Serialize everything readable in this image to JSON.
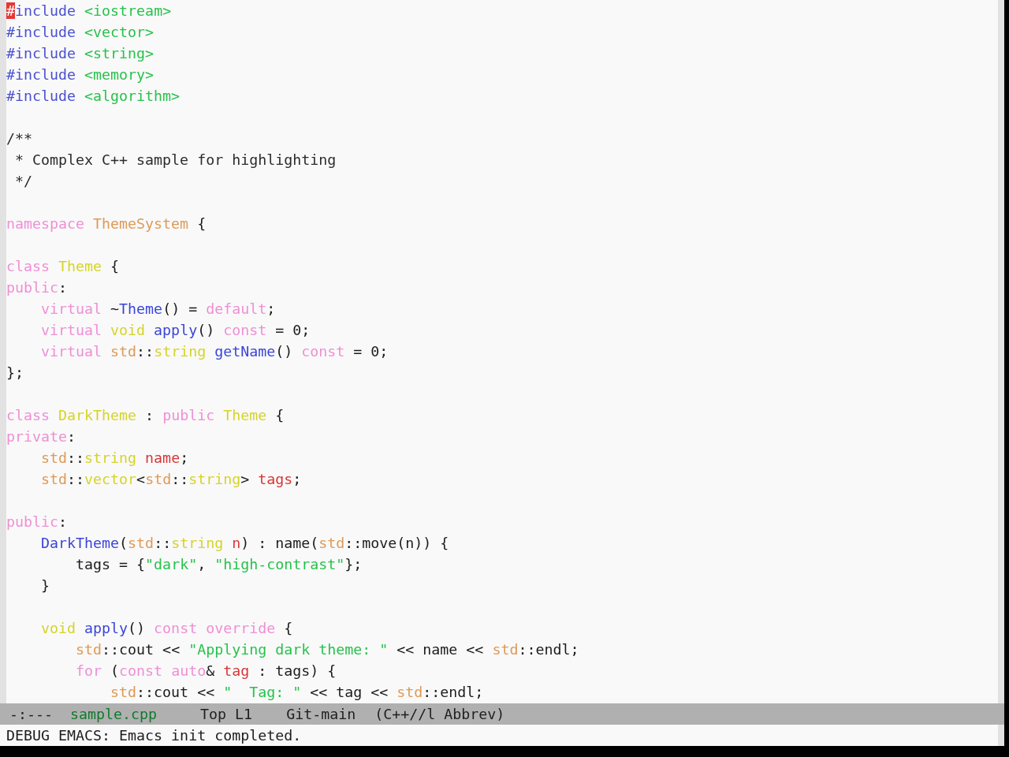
{
  "editor": {
    "lines": [
      {
        "kind": "code",
        "tokens": [
          {
            "text": "#",
            "kind": "cursor"
          },
          {
            "text": "include ",
            "kind": "preprocessor"
          },
          {
            "text": "<iostream>",
            "kind": "string"
          }
        ]
      },
      {
        "kind": "code",
        "tokens": [
          {
            "text": "#include ",
            "kind": "preprocessor"
          },
          {
            "text": "<vector>",
            "kind": "string"
          }
        ]
      },
      {
        "kind": "code",
        "tokens": [
          {
            "text": "#include ",
            "kind": "preprocessor"
          },
          {
            "text": "<string>",
            "kind": "string"
          }
        ]
      },
      {
        "kind": "code",
        "tokens": [
          {
            "text": "#include ",
            "kind": "preprocessor"
          },
          {
            "text": "<memory>",
            "kind": "string"
          }
        ]
      },
      {
        "kind": "code",
        "tokens": [
          {
            "text": "#include ",
            "kind": "preprocessor"
          },
          {
            "text": "<algorithm>",
            "kind": "string"
          }
        ]
      },
      {
        "kind": "blank"
      },
      {
        "kind": "code",
        "tokens": [
          {
            "text": "/**",
            "kind": "comment"
          }
        ]
      },
      {
        "kind": "code",
        "tokens": [
          {
            "text": " * Complex C++ sample for highlighting",
            "kind": "comment"
          }
        ]
      },
      {
        "kind": "code",
        "tokens": [
          {
            "text": " */",
            "kind": "comment"
          }
        ]
      },
      {
        "kind": "blank"
      },
      {
        "kind": "code",
        "tokens": [
          {
            "text": "namespace ",
            "kind": "keyword"
          },
          {
            "text": "ThemeSystem",
            "kind": "namespace"
          },
          {
            "text": " {",
            "kind": "plain"
          }
        ]
      },
      {
        "kind": "blank"
      },
      {
        "kind": "code",
        "tokens": [
          {
            "text": "class ",
            "kind": "keyword"
          },
          {
            "text": "Theme",
            "kind": "type"
          },
          {
            "text": " {",
            "kind": "plain"
          }
        ]
      },
      {
        "kind": "code",
        "tokens": [
          {
            "text": "public",
            "kind": "keyword"
          },
          {
            "text": ":",
            "kind": "plain"
          }
        ]
      },
      {
        "kind": "code",
        "tokens": [
          {
            "text": "    virtual ",
            "kind": "keyword"
          },
          {
            "text": "~",
            "kind": "plain"
          },
          {
            "text": "Theme",
            "kind": "function"
          },
          {
            "text": "() = ",
            "kind": "plain"
          },
          {
            "text": "default",
            "kind": "keyword"
          },
          {
            "text": ";",
            "kind": "plain"
          }
        ]
      },
      {
        "kind": "code",
        "tokens": [
          {
            "text": "    virtual ",
            "kind": "keyword"
          },
          {
            "text": "void ",
            "kind": "type"
          },
          {
            "text": "apply",
            "kind": "function"
          },
          {
            "text": "() ",
            "kind": "plain"
          },
          {
            "text": "const",
            "kind": "keyword"
          },
          {
            "text": " = 0;",
            "kind": "plain"
          }
        ]
      },
      {
        "kind": "code",
        "tokens": [
          {
            "text": "    virtual ",
            "kind": "keyword"
          },
          {
            "text": "std",
            "kind": "namespace"
          },
          {
            "text": "::",
            "kind": "plain"
          },
          {
            "text": "string ",
            "kind": "type"
          },
          {
            "text": "getName",
            "kind": "function"
          },
          {
            "text": "() ",
            "kind": "plain"
          },
          {
            "text": "const",
            "kind": "keyword"
          },
          {
            "text": " = 0;",
            "kind": "plain"
          }
        ]
      },
      {
        "kind": "code",
        "tokens": [
          {
            "text": "};",
            "kind": "plain"
          }
        ]
      },
      {
        "kind": "blank"
      },
      {
        "kind": "code",
        "tokens": [
          {
            "text": "class ",
            "kind": "keyword"
          },
          {
            "text": "DarkTheme",
            "kind": "type"
          },
          {
            "text": " : ",
            "kind": "plain"
          },
          {
            "text": "public ",
            "kind": "keyword"
          },
          {
            "text": "Theme",
            "kind": "type"
          },
          {
            "text": " {",
            "kind": "plain"
          }
        ]
      },
      {
        "kind": "code",
        "tokens": [
          {
            "text": "private",
            "kind": "keyword"
          },
          {
            "text": ":",
            "kind": "plain"
          }
        ]
      },
      {
        "kind": "code",
        "tokens": [
          {
            "text": "    std",
            "kind": "namespace"
          },
          {
            "text": "::",
            "kind": "plain"
          },
          {
            "text": "string ",
            "kind": "type"
          },
          {
            "text": "name",
            "kind": "variable"
          },
          {
            "text": ";",
            "kind": "plain"
          }
        ]
      },
      {
        "kind": "code",
        "tokens": [
          {
            "text": "    std",
            "kind": "namespace"
          },
          {
            "text": "::",
            "kind": "plain"
          },
          {
            "text": "vector",
            "kind": "type"
          },
          {
            "text": "<",
            "kind": "plain"
          },
          {
            "text": "std",
            "kind": "namespace"
          },
          {
            "text": "::",
            "kind": "plain"
          },
          {
            "text": "string",
            "kind": "type"
          },
          {
            "text": "> ",
            "kind": "plain"
          },
          {
            "text": "tags",
            "kind": "variable"
          },
          {
            "text": ";",
            "kind": "plain"
          }
        ]
      },
      {
        "kind": "blank"
      },
      {
        "kind": "code",
        "tokens": [
          {
            "text": "public",
            "kind": "keyword"
          },
          {
            "text": ":",
            "kind": "plain"
          }
        ]
      },
      {
        "kind": "code",
        "tokens": [
          {
            "text": "    DarkTheme",
            "kind": "function"
          },
          {
            "text": "(",
            "kind": "plain"
          },
          {
            "text": "std",
            "kind": "namespace"
          },
          {
            "text": "::",
            "kind": "plain"
          },
          {
            "text": "string ",
            "kind": "type"
          },
          {
            "text": "n",
            "kind": "variable"
          },
          {
            "text": ") : name(",
            "kind": "plain"
          },
          {
            "text": "std",
            "kind": "namespace"
          },
          {
            "text": "::move(n)) {",
            "kind": "plain"
          }
        ]
      },
      {
        "kind": "code",
        "tokens": [
          {
            "text": "        tags = {",
            "kind": "plain"
          },
          {
            "text": "\"dark\"",
            "kind": "string"
          },
          {
            "text": ", ",
            "kind": "plain"
          },
          {
            "text": "\"high-contrast\"",
            "kind": "string"
          },
          {
            "text": "};",
            "kind": "plain"
          }
        ]
      },
      {
        "kind": "code",
        "tokens": [
          {
            "text": "    }",
            "kind": "plain"
          }
        ]
      },
      {
        "kind": "blank"
      },
      {
        "kind": "code",
        "tokens": [
          {
            "text": "    void ",
            "kind": "type"
          },
          {
            "text": "apply",
            "kind": "function"
          },
          {
            "text": "() ",
            "kind": "plain"
          },
          {
            "text": "const override",
            "kind": "keyword"
          },
          {
            "text": " {",
            "kind": "plain"
          }
        ]
      },
      {
        "kind": "code",
        "tokens": [
          {
            "text": "        std",
            "kind": "namespace"
          },
          {
            "text": "::cout << ",
            "kind": "plain"
          },
          {
            "text": "\"Applying dark theme: \"",
            "kind": "string"
          },
          {
            "text": " << name << ",
            "kind": "plain"
          },
          {
            "text": "std",
            "kind": "namespace"
          },
          {
            "text": "::endl;",
            "kind": "plain"
          }
        ]
      },
      {
        "kind": "code",
        "tokens": [
          {
            "text": "        for ",
            "kind": "keyword"
          },
          {
            "text": "(",
            "kind": "plain"
          },
          {
            "text": "const auto",
            "kind": "keyword"
          },
          {
            "text": "& ",
            "kind": "plain"
          },
          {
            "text": "tag",
            "kind": "variable"
          },
          {
            "text": " : tags) {",
            "kind": "plain"
          }
        ]
      },
      {
        "kind": "code",
        "tokens": [
          {
            "text": "            std",
            "kind": "namespace"
          },
          {
            "text": "::cout << ",
            "kind": "plain"
          },
          {
            "text": "\"  Tag: \"",
            "kind": "string"
          },
          {
            "text": " << tag << ",
            "kind": "plain"
          },
          {
            "text": "std",
            "kind": "namespace"
          },
          {
            "text": "::endl;",
            "kind": "plain"
          }
        ]
      }
    ]
  },
  "mode_line": {
    "status": "-:---",
    "buffer_name": "sample.cpp",
    "position": "Top L1",
    "branch": "Git-main",
    "modes": "(C++//l Abbrev)"
  },
  "echo_area": {
    "message": "DEBUG EMACS: Emacs init completed."
  }
}
